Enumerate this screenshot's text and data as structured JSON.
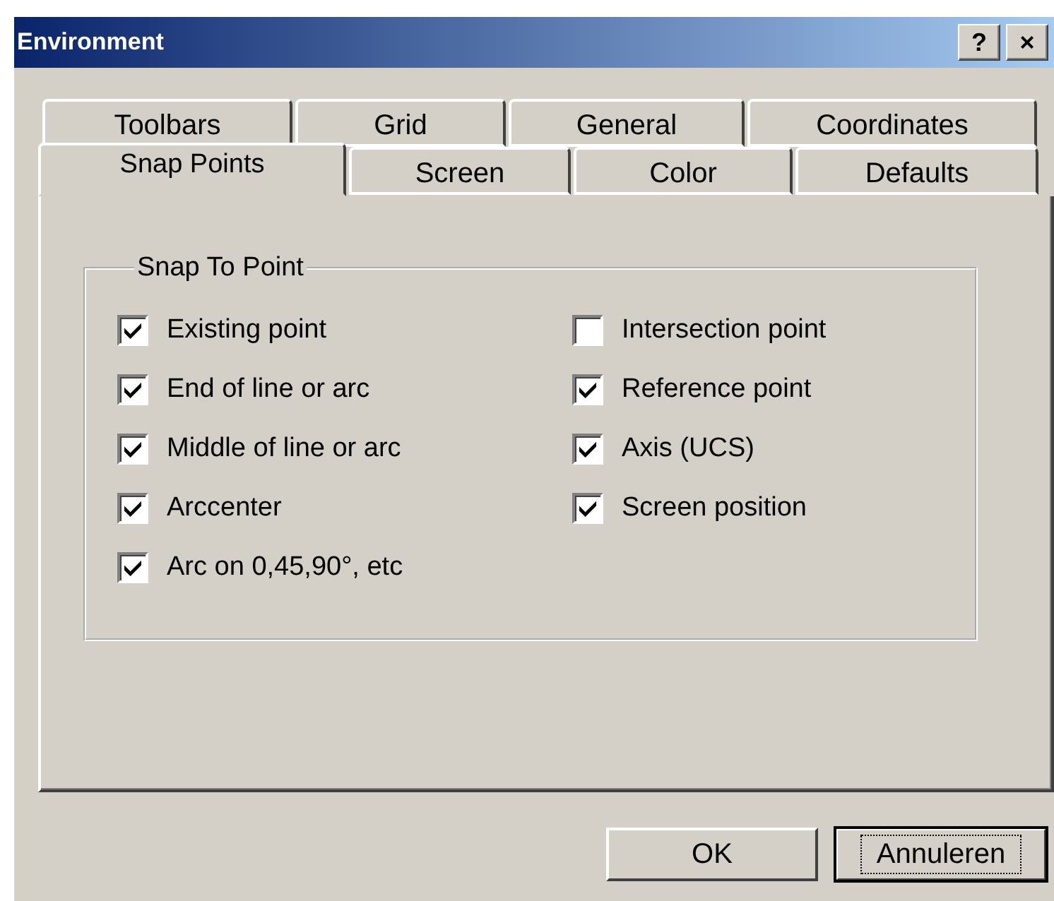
{
  "window": {
    "title": "Environment",
    "help_button": "?",
    "close_button": "×"
  },
  "tab_rows": [
    [
      {
        "label": "Toolbars",
        "selected": false
      },
      {
        "label": "Grid",
        "selected": false
      },
      {
        "label": "General",
        "selected": false
      },
      {
        "label": "Coordinates",
        "selected": false
      }
    ],
    [
      {
        "label": "Snap Points",
        "selected": true
      },
      {
        "label": "Screen",
        "selected": false
      },
      {
        "label": "Color",
        "selected": false
      },
      {
        "label": "Defaults",
        "selected": false
      }
    ]
  ],
  "group": {
    "title": "Snap To Point",
    "columns": [
      [
        {
          "label": "Existing point",
          "checked": true
        },
        {
          "label": "End of line or arc",
          "checked": true
        },
        {
          "label": "Middle of line or arc",
          "checked": true
        },
        {
          "label": "Arccenter",
          "checked": true
        },
        {
          "label": "Arc on 0,45,90°, etc",
          "checked": true
        }
      ],
      [
        {
          "label": "Intersection point",
          "checked": false
        },
        {
          "label": "Reference point",
          "checked": true
        },
        {
          "label": "Axis (UCS)",
          "checked": true
        },
        {
          "label": "Screen position",
          "checked": true
        }
      ]
    ]
  },
  "buttons": [
    {
      "label": "OK",
      "default": false
    },
    {
      "label": "Annuleren",
      "default": true
    }
  ]
}
